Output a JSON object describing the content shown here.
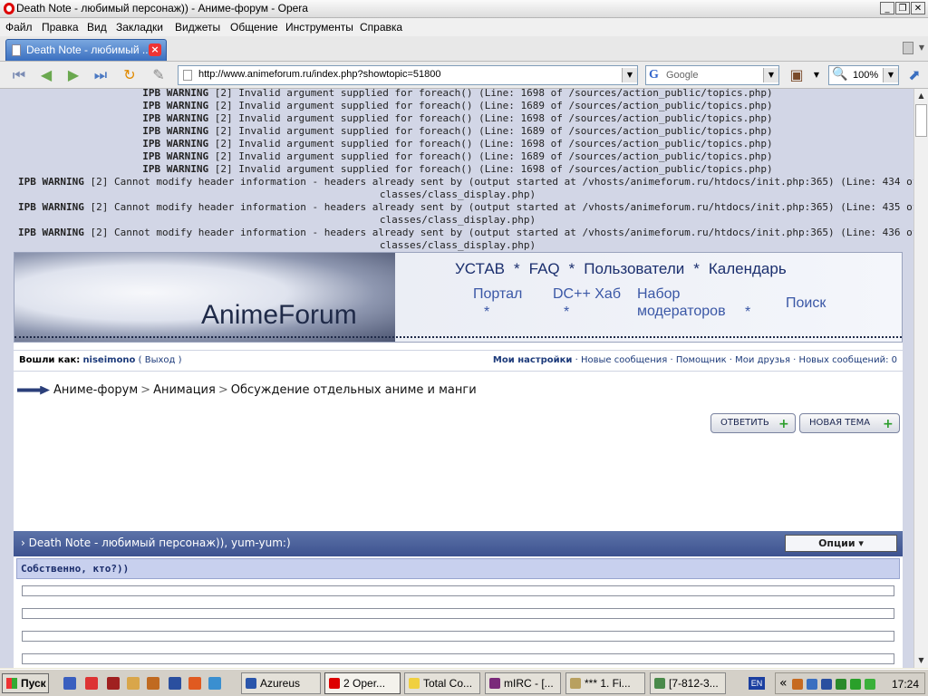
{
  "window": {
    "title": "Death Note - любимый персонаж)) - Аниме-форум - Opera"
  },
  "menu": [
    "Файл",
    "Правка",
    "Вид",
    "Закладки",
    "Виджеты",
    "Общение",
    "Инструменты",
    "Справка"
  ],
  "tab": {
    "label": "Death Note - любимый ..."
  },
  "address": {
    "url": "http://www.animeforum.ru/index.php?showtopic=51800"
  },
  "search": {
    "placeholder": "Google"
  },
  "zoom": {
    "value": "100%"
  },
  "warnings": [
    {
      "lead": "IPB WARNING",
      "text": "[2] Invalid argument supplied for foreach() (Line: 1698 of /sources/action_public/topics.php)"
    },
    {
      "lead": "IPB WARNING",
      "text": "[2] Invalid argument supplied for foreach() (Line: 1689 of /sources/action_public/topics.php)"
    },
    {
      "lead": "IPB WARNING",
      "text": "[2] Invalid argument supplied for foreach() (Line: 1698 of /sources/action_public/topics.php)"
    },
    {
      "lead": "IPB WARNING",
      "text": "[2] Invalid argument supplied for foreach() (Line: 1689 of /sources/action_public/topics.php)"
    },
    {
      "lead": "IPB WARNING",
      "text": "[2] Invalid argument supplied for foreach() (Line: 1698 of /sources/action_public/topics.php)"
    },
    {
      "lead": "IPB WARNING",
      "text": "[2] Invalid argument supplied for foreach() (Line: 1689 of /sources/action_public/topics.php)"
    },
    {
      "lead": "IPB WARNING",
      "text": "[2] Invalid argument supplied for foreach() (Line: 1698 of /sources/action_public/topics.php)"
    }
  ],
  "header_warnings": [
    {
      "lead": "IPB WARNING",
      "text": "[2] Cannot modify header information - headers already sent by (output started at /vhosts/animeforum.ru/htdocs/init.php:365) (Line: 434 of /sources/",
      "cont": "classes/class_display.php)"
    },
    {
      "lead": "IPB WARNING",
      "text": "[2] Cannot modify header information - headers already sent by (output started at /vhosts/animeforum.ru/htdocs/init.php:365) (Line: 435 of /sources/",
      "cont": "classes/class_display.php)"
    },
    {
      "lead": "IPB WARNING",
      "text": "[2] Cannot modify header information - headers already sent by (output started at /vhosts/animeforum.ru/htdocs/init.php:365) (Line: 436 of /sources/",
      "cont": "classes/class_display.php)"
    }
  ],
  "banner": {
    "logo": "AnimeForum",
    "nav_top": [
      "УСТАВ",
      "FAQ",
      "Пользователи",
      "Календарь"
    ],
    "nav_sep": "*",
    "portal": "Портал",
    "dchub": "DC++ Хаб",
    "moderators_1": "Набор",
    "moderators_2": "модераторов",
    "search": "Поиск"
  },
  "userbar": {
    "logged_as": "Вошли как:",
    "username": "niseimono",
    "logout": "( Выход )",
    "links": [
      "Мои настройки",
      "Новые сообщения",
      "Помощник",
      "Мои друзья",
      "Новых сообщений: 0"
    ]
  },
  "breadcrumb": [
    "Аниме-форум",
    "Анимация",
    "Обсуждение отдельных аниме и манги"
  ],
  "buttons": {
    "reply": "ОТВЕТИТЬ",
    "new_topic": "НОВАЯ ТЕМА"
  },
  "topic": {
    "title": "Death Note - любимый персонаж)), yum-yum:)",
    "options": "Опции ▾",
    "first_post": "Собственно, кто?))"
  },
  "taskbar": {
    "start": "Пуск",
    "tasks": [
      "Azureus",
      "2 Oper...",
      "Total Co...",
      "mIRC - [...",
      "*** 1. Fi...",
      "[7-812-3..."
    ],
    "lang": "EN",
    "clock": "17:24"
  }
}
